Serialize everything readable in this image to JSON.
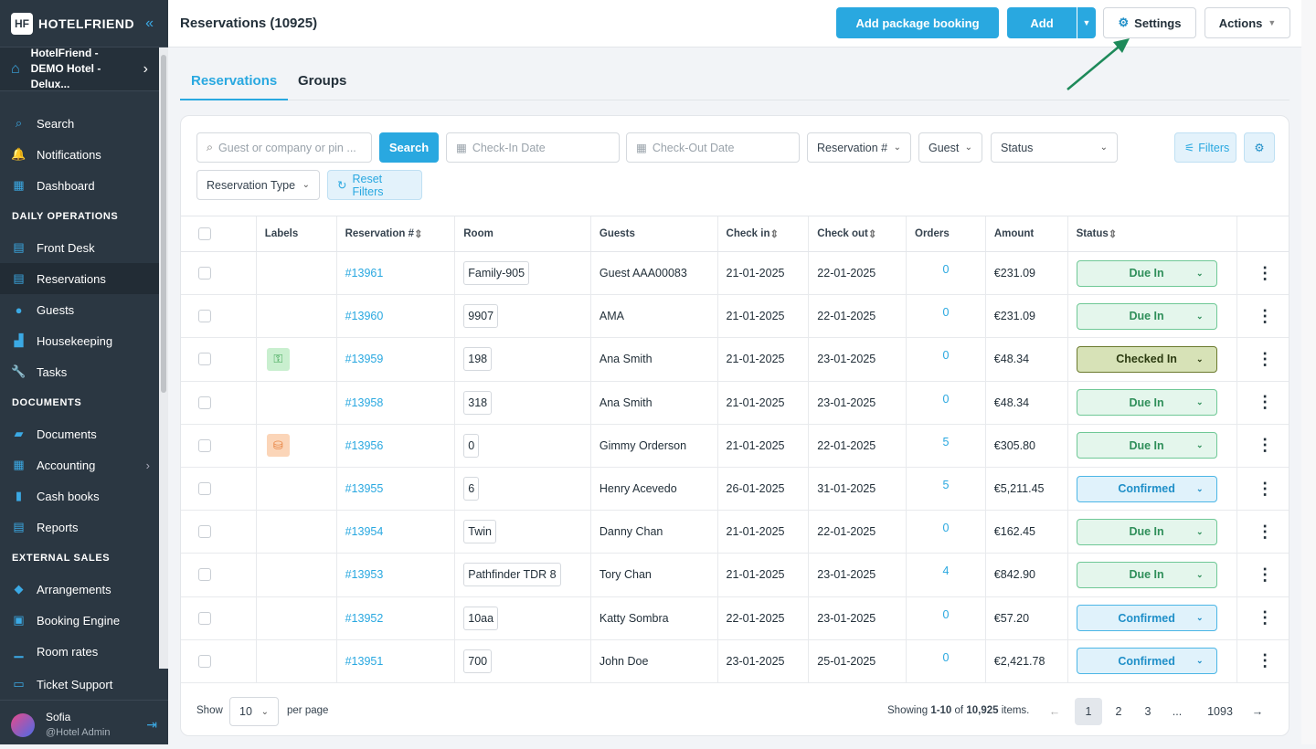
{
  "sidebar": {
    "brand": "HOTELFRIEND",
    "hotel_name": "HotelFriend - DEMO Hotel - Delux...",
    "items_top": [
      {
        "label": "Search",
        "icon": "search-icon"
      },
      {
        "label": "Notifications",
        "icon": "bell-icon"
      },
      {
        "label": "Dashboard",
        "icon": "dashboard-icon"
      }
    ],
    "section_daily": "DAILY OPERATIONS",
    "items_daily": [
      {
        "label": "Front Desk",
        "icon": "front-desk-icon"
      },
      {
        "label": "Reservations",
        "icon": "reservations-icon"
      },
      {
        "label": "Guests",
        "icon": "guest-icon"
      },
      {
        "label": "Housekeeping",
        "icon": "housekeeping-icon"
      },
      {
        "label": "Tasks",
        "icon": "wrench-icon"
      }
    ],
    "section_documents": "DOCUMENTS",
    "items_documents": [
      {
        "label": "Documents",
        "icon": "folder-icon"
      },
      {
        "label": "Accounting",
        "icon": "accounting-icon"
      },
      {
        "label": "Cash books",
        "icon": "book-icon"
      },
      {
        "label": "Reports",
        "icon": "reports-icon"
      }
    ],
    "section_external": "EXTERNAL SALES",
    "items_external": [
      {
        "label": "Arrangements",
        "icon": "tag-icon"
      },
      {
        "label": "Booking Engine",
        "icon": "booking-engine-icon"
      },
      {
        "label": "Room rates",
        "icon": "chart-icon"
      }
    ],
    "ticket_support": "Ticket Support",
    "user_name": "Sofia",
    "user_role": "@Hotel Admin"
  },
  "header": {
    "title": "Reservations (10925)",
    "add_package": "Add package booking",
    "add": "Add",
    "settings": "Settings",
    "actions": "Actions"
  },
  "tabs": [
    "Reservations",
    "Groups"
  ],
  "filters": {
    "search_placeholder": "Guest or company or pin ...",
    "search_button": "Search",
    "checkin_placeholder": "Check-In Date",
    "checkout_placeholder": "Check-Out Date",
    "reservation_num": "Reservation #",
    "guest": "Guest",
    "status": "Status",
    "filters_button": "Filters",
    "reservation_type": "Reservation Type",
    "reset": "Reset Filters"
  },
  "columns": [
    "Labels",
    "Reservation #",
    "Room",
    "Guests",
    "Check in",
    "Check out",
    "Orders",
    "Amount",
    "Status"
  ],
  "rows": [
    {
      "label": "",
      "res": "#13961",
      "room": "Family-905",
      "guest": "Guest AAA00083",
      "in": "21-01-2025",
      "out": "22-01-2025",
      "orders": "0",
      "amount": "€231.09",
      "status": "Due In",
      "st": "due"
    },
    {
      "label": "",
      "res": "#13960",
      "room": "9907",
      "guest": "AMA",
      "in": "21-01-2025",
      "out": "22-01-2025",
      "orders": "0",
      "amount": "€231.09",
      "status": "Due In",
      "st": "due"
    },
    {
      "label": "key",
      "res": "#13959",
      "room": "198",
      "guest": "Ana Smith",
      "in": "21-01-2025",
      "out": "23-01-2025",
      "orders": "0",
      "amount": "€48.34",
      "status": "Checked In",
      "st": "in"
    },
    {
      "label": "",
      "res": "#13958",
      "room": "318",
      "guest": "Ana Smith",
      "in": "21-01-2025",
      "out": "23-01-2025",
      "orders": "0",
      "amount": "€48.34",
      "status": "Due In",
      "st": "due"
    },
    {
      "label": "bag",
      "res": "#13956",
      "room": "0",
      "guest": "Gimmy Orderson",
      "in": "21-01-2025",
      "out": "22-01-2025",
      "orders": "5",
      "amount": "€305.80",
      "status": "Due In",
      "st": "due"
    },
    {
      "label": "",
      "res": "#13955",
      "room": "6",
      "guest": "Henry Acevedo",
      "in": "26-01-2025",
      "out": "31-01-2025",
      "orders": "5",
      "amount": "€5,211.45",
      "status": "Confirmed",
      "st": "conf"
    },
    {
      "label": "",
      "res": "#13954",
      "room": "Twin",
      "guest": "Danny Chan",
      "in": "21-01-2025",
      "out": "22-01-2025",
      "orders": "0",
      "amount": "€162.45",
      "status": "Due In",
      "st": "due"
    },
    {
      "label": "",
      "res": "#13953",
      "room": "Pathfinder TDR 8",
      "guest": "Tory Chan",
      "in": "21-01-2025",
      "out": "23-01-2025",
      "orders": "4",
      "amount": "€842.90",
      "status": "Due In",
      "st": "due"
    },
    {
      "label": "",
      "res": "#13952",
      "room": "10aa",
      "guest": "Katty Sombra",
      "in": "22-01-2025",
      "out": "23-01-2025",
      "orders": "0",
      "amount": "€57.20",
      "status": "Confirmed",
      "st": "conf"
    },
    {
      "label": "",
      "res": "#13951",
      "room": "700",
      "guest": "John Doe",
      "in": "23-01-2025",
      "out": "25-01-2025",
      "orders": "0",
      "amount": "€2,421.78",
      "status": "Confirmed",
      "st": "conf"
    }
  ],
  "pager": {
    "show": "Show",
    "per_page_value": "10",
    "per_page": "per page",
    "showing_prefix": "Showing ",
    "showing_range": "1-10",
    "showing_of": " of ",
    "showing_total": "10,925",
    "showing_suffix": " items.",
    "pages": [
      "1",
      "2",
      "3",
      "...",
      "1093"
    ]
  }
}
